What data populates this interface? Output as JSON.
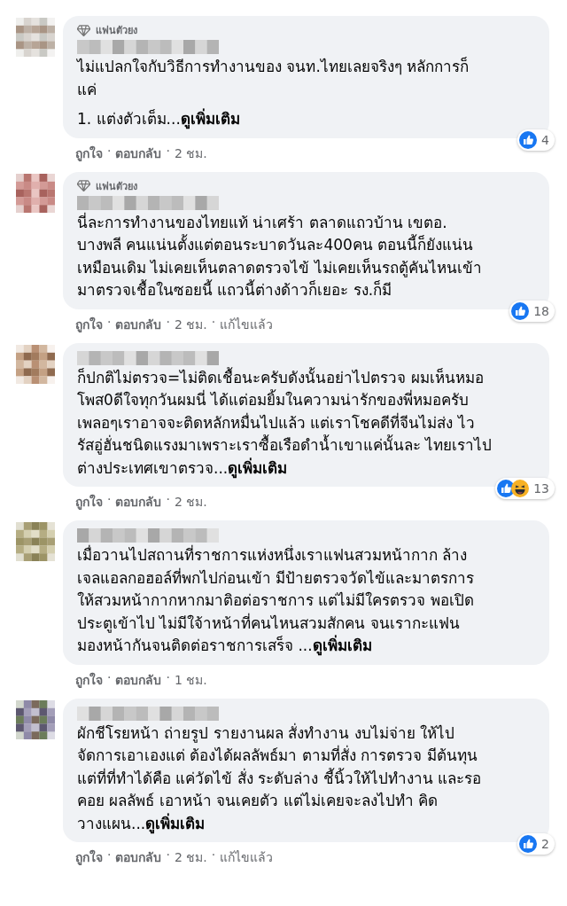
{
  "comments": [
    {
      "badge": "แฟนตัวยง",
      "paragraphs": [
        [
          "ไม่แปลกใจกับวิธีการทำงานของ จนท.ไทยเลยจริงๆ หลักการก็",
          "แค่"
        ],
        [
          "1. แต่งตัวเต็ม..."
        ]
      ],
      "see_more": "ดูเพิ่มเติม",
      "reactions": [
        {
          "kind": "like"
        }
      ],
      "reaction_count": "4",
      "like": "ถูกใจ",
      "reply": "ตอบกลับ",
      "time": "2 ชม.",
      "separator": "·"
    },
    {
      "badge": "แฟนตัวยง",
      "paragraphs": [
        [
          "นี่ละการทำงานของไทยแท้ น่าเศร้า ตลาดแถวบ้าน เขตอ.",
          "บางพลี คนแน่นตั้งแต่ตอนระบาดวันละ400คน ตอนนี้ก็ยังแน่น",
          "เหมือนเดิม ไม่เคยเห็นตลาดตรวจไข้ ไม่เคยเห็นรถตู้คันไหนเข้า",
          "มาตรวจเชื้อในซอยนี้ แถวนี้ต่างด้าวก็เยอะ รง.ก็มี"
        ]
      ],
      "reactions": [
        {
          "kind": "like"
        }
      ],
      "reaction_count": "18",
      "like": "ถูกใจ",
      "reply": "ตอบกลับ",
      "time": "2 ชม.",
      "edited": "แก้ไขแล้ว",
      "separator": "·"
    },
    {
      "paragraphs": [
        [
          "ก็ปกติไม่ตรวจ=ไม่ติดเชื้อนะครับดังนั้นอย่าไปตรวจ ผมเห็นหมอ",
          "โพส0ดีใจทุกวันผมนี่ ได้แต่อมยิ้มในความน่ารักของพี่หมอครับ",
          "เพลอๆเราอาจจะติดหลักหมื่นไปแล้ว แต่เราโชคดีที่จีนไม่ส่ง ไว",
          "รัสอู่ฮั่นชนิดแรงมาเพราะเราซื้อเรือดำน้ำเขาแค่นั้นละ ไทยเราไป",
          "ต่างประเทศเขาตรวจ..."
        ]
      ],
      "see_more": "ดูเพิ่มเติม",
      "reactions": [
        {
          "kind": "like"
        },
        {
          "kind": "haha"
        }
      ],
      "reaction_count": "13",
      "like": "ถูกใจ",
      "reply": "ตอบกลับ",
      "time": "2 ชม.",
      "separator": "·"
    },
    {
      "paragraphs": [
        [
          "เมื่อวานไปสถานที่ราชการแห่งหนึ่งเราแฟนสวมหน้ากาก ล้าง",
          "เจลแอลกอฮอล์ที่พกไปก่อนเข้า มีป้ายตรวจวัดไข้และมาตรการ",
          "ให้สวมหน้ากากหากมาติอต่อราชการ แต่ไม่มีใครตรวจ พอเปิด",
          "ประตูเข้าไป ไม่มีใจ้าหน้าที่คนไหนสวมสักคน จนเรากะแฟน",
          "มองหน้ากันจนติดต่อราชการเสร็จ ..."
        ]
      ],
      "see_more": "ดูเพิ่มเติม",
      "like": "ถูกใจ",
      "reply": "ตอบกลับ",
      "time": "1 ชม.",
      "separator": "·"
    },
    {
      "paragraphs": [
        [
          "ผักชีโรยหน้า ถ่ายรูป รายงานผล สั่งทำงาน งบไม่จ่าย ให้ไป",
          "จัดการเอาเองแต่ ต้องได้ผลลัพธ์มา ตามที่สั่ง การตรวจ มีต้นทุน",
          "แต่ที่ที่ทำได้คือ แค่วัดไข้ สั่ง ระดับล่าง ชี้นิ้วให้ไปทำงาน และรอ",
          "คอย ผลลัพธ์ เอาหน้า จนเคยตัว แต่ไม่เคยจะลงไปทำ คิด",
          "วางแผน..."
        ]
      ],
      "see_more": "ดูเพิ่มเติม",
      "reactions": [
        {
          "kind": "like"
        }
      ],
      "reaction_count": "2",
      "like": "ถูกใจ",
      "reply": "ตอบกลับ",
      "time": "2 ชม.",
      "edited": "แก้ไขแล้ว",
      "separator": "·"
    }
  ]
}
